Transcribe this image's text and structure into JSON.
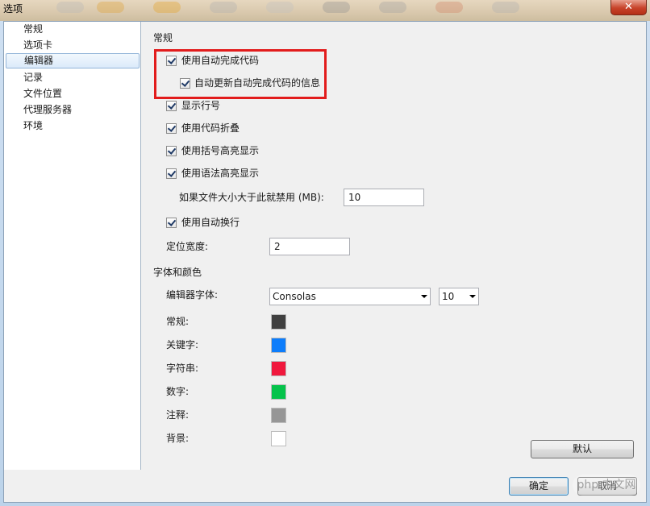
{
  "window": {
    "title": "选项",
    "close_glyph": "✕"
  },
  "nav": {
    "items": [
      {
        "label": "常规",
        "selected": false
      },
      {
        "label": "选项卡",
        "selected": false
      },
      {
        "label": "编辑器",
        "selected": true
      },
      {
        "label": "记录",
        "selected": false
      },
      {
        "label": "文件位置",
        "selected": false
      },
      {
        "label": "代理服务器",
        "selected": false
      },
      {
        "label": "环境",
        "selected": false
      }
    ]
  },
  "general": {
    "header": "常规",
    "autocomplete": {
      "label": "使用自动完成代码",
      "checked": true
    },
    "autocomplete_update": {
      "label": "自动更新自动完成代码的信息",
      "checked": true
    },
    "line_numbers": {
      "label": "显示行号",
      "checked": true
    },
    "code_folding": {
      "label": "使用代码折叠",
      "checked": true
    },
    "bracket_highlight": {
      "label": "使用括号高亮显示",
      "checked": true
    },
    "syntax_highlight": {
      "label": "使用语法高亮显示",
      "checked": true
    },
    "disable_if_larger": {
      "label": "如果文件大小大于此就禁用 (MB):",
      "value": "10"
    },
    "word_wrap": {
      "label": "使用自动换行",
      "checked": true
    },
    "tab_width": {
      "label": "定位宽度:",
      "value": "2"
    }
  },
  "fonts": {
    "header": "字体和颜色",
    "editor_font": {
      "label": "编辑器字体:",
      "value": "Consolas",
      "size": "10"
    },
    "colors": [
      {
        "label": "常规:",
        "color": "#404040"
      },
      {
        "label": "关键字:",
        "color": "#0d7dfb"
      },
      {
        "label": "字符串:",
        "color": "#f0183d"
      },
      {
        "label": "数字:",
        "color": "#05c34b"
      },
      {
        "label": "注释:",
        "color": "#969696"
      },
      {
        "label": "背景:",
        "color": "#ffffff"
      }
    ],
    "default_button": "默认"
  },
  "footer": {
    "ok": "确定",
    "cancel": "取消",
    "watermark": "php 中文网"
  },
  "annotation": {
    "highlight_color": "#e21c1c"
  }
}
